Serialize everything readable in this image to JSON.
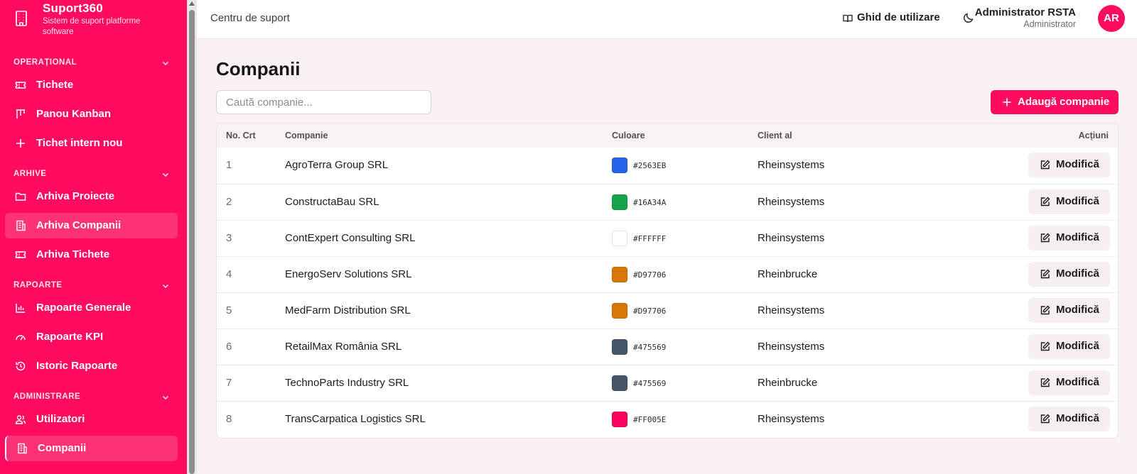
{
  "brand": {
    "title": "Suport360",
    "subtitle": "Sistem de suport platforme software"
  },
  "sidebar": {
    "sections": [
      {
        "label": "OPERAȚIONAL"
      },
      {
        "label": "ARHIVE"
      },
      {
        "label": "RAPOARTE"
      },
      {
        "label": "ADMINISTRARE"
      }
    ],
    "items": [
      {
        "label": "Tichete",
        "icon": "ticket-icon"
      },
      {
        "label": "Panou Kanban",
        "icon": "kanban-icon"
      },
      {
        "label": "Tichet intern nou",
        "icon": "plus-icon"
      },
      {
        "label": "Arhiva Proiecte",
        "icon": "folder-icon"
      },
      {
        "label": "Arhiva Companii",
        "icon": "building-icon"
      },
      {
        "label": "Arhiva Tichete",
        "icon": "ticket-icon"
      },
      {
        "label": "Rapoarte Generale",
        "icon": "bar-chart-icon"
      },
      {
        "label": "Rapoarte KPI",
        "icon": "gauge-icon"
      },
      {
        "label": "Istoric Rapoarte",
        "icon": "history-icon"
      },
      {
        "label": "Utilizatori",
        "icon": "users-icon"
      },
      {
        "label": "Companii",
        "icon": "building-icon"
      }
    ]
  },
  "header": {
    "breadcrumb": "Centru de suport",
    "guide_label": "Ghid de utilizare",
    "user_name": "Administrator RSTA",
    "user_role": "Administrator",
    "avatar_initials": "AR"
  },
  "main": {
    "title": "Companii",
    "search_placeholder": "Caută companie...",
    "add_button_label": "Adaugă companie",
    "columns": [
      "No. Crt",
      "Companie",
      "Culoare",
      "Client al",
      "Acțiuni"
    ],
    "edit_label": "Modifică",
    "rows": [
      {
        "no": "1",
        "name": "AgroTerra Group SRL",
        "color": "#2563EB",
        "client": "Rheinsystems"
      },
      {
        "no": "2",
        "name": "ConstructaBau SRL",
        "color": "#16A34A",
        "client": "Rheinsystems"
      },
      {
        "no": "3",
        "name": "ContExpert Consulting SRL",
        "color": "#FFFFFF",
        "client": "Rheinsystems"
      },
      {
        "no": "4",
        "name": "EnergoServ Solutions SRL",
        "color": "#D97706",
        "client": "Rheinbrucke"
      },
      {
        "no": "5",
        "name": "MedFarm Distribution SRL",
        "color": "#D97706",
        "client": "Rheinsystems"
      },
      {
        "no": "6",
        "name": "RetailMax România SRL",
        "color": "#475569",
        "client": "Rheinsystems"
      },
      {
        "no": "7",
        "name": "TechnoParts Industry SRL",
        "color": "#475569",
        "client": "Rheinbrucke"
      },
      {
        "no": "8",
        "name": "TransCarpatica Logistics SRL",
        "color": "#FF005E",
        "client": "Rheinsystems"
      }
    ]
  },
  "colors": {
    "accent": "#ff0b5f",
    "page_bg": "#f9f1f3"
  }
}
